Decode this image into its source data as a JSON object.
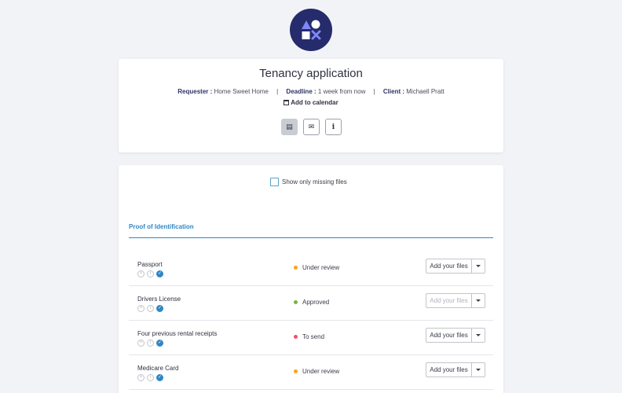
{
  "header": {
    "title": "Tenancy application",
    "requester_label": "Requester :",
    "requester_value": "Home Sweet Home",
    "deadline_label": "Deadline :",
    "deadline_value": "1 week from now",
    "client_label": "Client :",
    "client_value": "Michaell Pratt",
    "separator": "|",
    "calendar_link": "Add to calendar"
  },
  "toolbar": {
    "buttons": [
      {
        "icon": "document-icon",
        "glyph": "▤",
        "active": true
      },
      {
        "icon": "envelope-icon",
        "glyph": "✉",
        "active": false
      },
      {
        "icon": "info-icon",
        "glyph": "i",
        "active": false
      }
    ]
  },
  "filter": {
    "missing_label": "Show only missing files"
  },
  "section": {
    "title": "Proof of Identification"
  },
  "mini_icons": {
    "remove": "×",
    "info": "i",
    "required": "✓"
  },
  "documents": [
    {
      "name": "Passport",
      "status": "Under review",
      "status_key": "review",
      "button": "Add your files",
      "disabled": false
    },
    {
      "name": "Drivers License",
      "status": "Approved",
      "status_key": "approved",
      "button": "Add your files",
      "disabled": true
    },
    {
      "name": "Four previous rental receipts",
      "status": "To send",
      "status_key": "send",
      "button": "Add your files",
      "disabled": false
    },
    {
      "name": "Medicare Card",
      "status": "Under review",
      "status_key": "review",
      "button": "Add your files",
      "disabled": false
    }
  ],
  "colors": {
    "brand": "#252b6b",
    "accent": "#2f87c4",
    "review": "#f5a623",
    "approved": "#7cb342",
    "send": "#f0506e"
  }
}
